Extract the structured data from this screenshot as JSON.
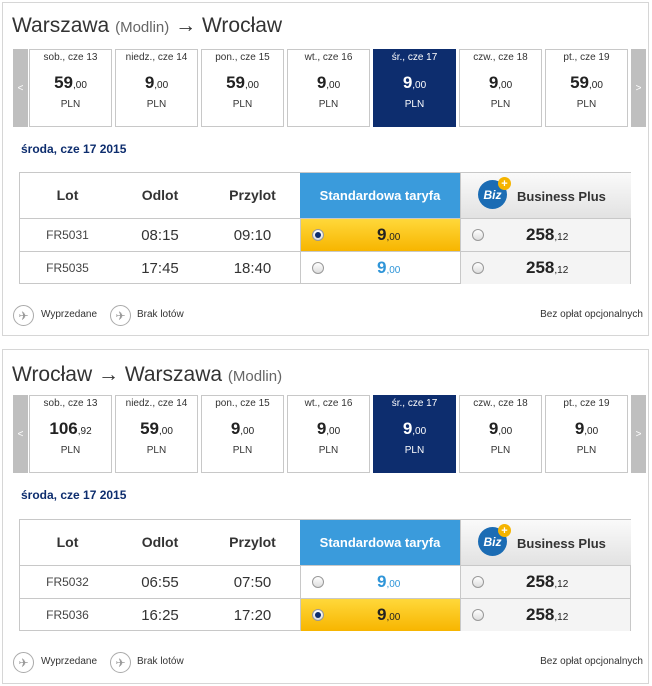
{
  "legend_labels": {
    "sold_out": "Wyprzedane",
    "no_flights": "Brak lotów",
    "no_fees": "Bez opłat opcjonalnych"
  },
  "legend_icons": {
    "sold_out": "sold-out-plane-icon",
    "no_flights": "no-flights-plane-icon"
  },
  "colors": {
    "selected_day": "#0d2d6e",
    "standard_header": "#3a9bdc",
    "selected_fare": "#f7b500",
    "price_blue": "#2f95d8"
  },
  "table_headers": {
    "flight": "Lot",
    "departure": "Odlot",
    "arrival": "Przylot",
    "standard": "Standardowa taryfa",
    "business": "Business Plus",
    "biz_logo": "Biz",
    "biz_plus": "+"
  },
  "panels": [
    {
      "from": "Warszawa",
      "from_sub": "(Modlin)",
      "arrow": "→",
      "to": "Wrocław",
      "to_sub": "",
      "nav_prev": "<",
      "nav_next": ">",
      "days": [
        {
          "label": "sob., cze 13",
          "price": "59",
          "cents": ",00",
          "currency": "PLN",
          "selected": false
        },
        {
          "label": "niedz., cze 14",
          "price": "9",
          "cents": ",00",
          "currency": "PLN",
          "selected": false
        },
        {
          "label": "pon., cze 15",
          "price": "59",
          "cents": ",00",
          "currency": "PLN",
          "selected": false
        },
        {
          "label": "wt., cze 16",
          "price": "9",
          "cents": ",00",
          "currency": "PLN",
          "selected": false
        },
        {
          "label": "śr., cze 17",
          "price": "9",
          "cents": ",00",
          "currency": "PLN",
          "selected": true
        },
        {
          "label": "czw., cze 18",
          "price": "9",
          "cents": ",00",
          "currency": "PLN",
          "selected": false
        },
        {
          "label": "pt., cze 19",
          "price": "59",
          "cents": ",00",
          "currency": "PLN",
          "selected": false
        }
      ],
      "date_line": "środa, cze 17 2015",
      "flights": [
        {
          "number": "FR5031",
          "depart": "08:15",
          "arrive": "09:10",
          "std_price": "9",
          "std_cents": ",00",
          "std_selected": true,
          "biz_price": "258",
          "biz_cents": ",12"
        },
        {
          "number": "FR5035",
          "depart": "17:45",
          "arrive": "18:40",
          "std_price": "9",
          "std_cents": ",00",
          "std_selected": false,
          "biz_price": "258",
          "biz_cents": ",12"
        }
      ]
    },
    {
      "from": "Wrocław",
      "from_sub": "",
      "arrow": "→",
      "to": "Warszawa",
      "to_sub": "(Modlin)",
      "nav_prev": "<",
      "nav_next": ">",
      "days": [
        {
          "label": "sob., cze 13",
          "price": "106",
          "cents": ",92",
          "currency": "PLN",
          "selected": false
        },
        {
          "label": "niedz., cze 14",
          "price": "59",
          "cents": ",00",
          "currency": "PLN",
          "selected": false
        },
        {
          "label": "pon., cze 15",
          "price": "9",
          "cents": ",00",
          "currency": "PLN",
          "selected": false
        },
        {
          "label": "wt., cze 16",
          "price": "9",
          "cents": ",00",
          "currency": "PLN",
          "selected": false
        },
        {
          "label": "śr., cze 17",
          "price": "9",
          "cents": ",00",
          "currency": "PLN",
          "selected": true
        },
        {
          "label": "czw., cze 18",
          "price": "9",
          "cents": ",00",
          "currency": "PLN",
          "selected": false
        },
        {
          "label": "pt., cze 19",
          "price": "9",
          "cents": ",00",
          "currency": "PLN",
          "selected": false
        }
      ],
      "date_line": "środa, cze 17 2015",
      "flights": [
        {
          "number": "FR5032",
          "depart": "06:55",
          "arrive": "07:50",
          "std_price": "9",
          "std_cents": ",00",
          "std_selected": false,
          "biz_price": "258",
          "biz_cents": ",12"
        },
        {
          "number": "FR5036",
          "depart": "16:25",
          "arrive": "17:20",
          "std_price": "9",
          "std_cents": ",00",
          "std_selected": true,
          "biz_price": "258",
          "biz_cents": ",12"
        }
      ]
    }
  ]
}
